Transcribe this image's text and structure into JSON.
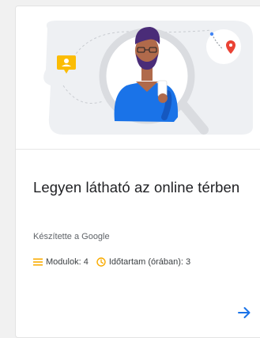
{
  "card": {
    "title": "Legyen látható az online térben",
    "author": "Készítette a Google",
    "modules_label": "Modulok: 4",
    "duration_label": "Időtartam (órában): 3"
  },
  "icons": {
    "modules": "list-lines-icon",
    "duration": "clock-icon",
    "action": "arrow-right-icon"
  },
  "colors": {
    "accent_yellow": "#f9ab00",
    "accent_blue": "#1a73e8",
    "map_pin_red": "#ea4335"
  }
}
